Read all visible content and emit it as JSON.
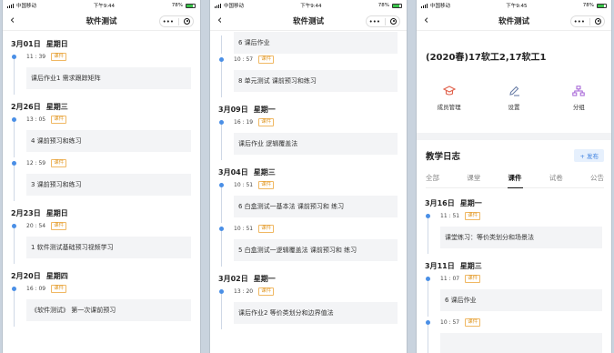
{
  "status": {
    "carrier": "中国移动",
    "time1": "下午9:44",
    "time2": "下午9:44",
    "time3": "下午9:45",
    "battery_text": "78%",
    "battery_level": 0.78
  },
  "nav": {
    "title": "软件测试",
    "more": "•••"
  },
  "colors": {
    "accent": "#4a8fe6",
    "badge": "#e19a2a",
    "publish": "#3a7fe0"
  },
  "phone1": [
    {
      "date": "3月01日",
      "weekday": "星期日",
      "entries": [
        {
          "time": "11 : 39",
          "badge": "课件",
          "text": "课后作业1 需求跟踪矩阵"
        }
      ]
    },
    {
      "date": "2月26日",
      "weekday": "星期三",
      "entries": [
        {
          "time": "13 : 05",
          "badge": "课件",
          "text": "4 课前预习和练习"
        },
        {
          "time": "12 : 59",
          "badge": "课件",
          "text": "3 课前预习和练习"
        }
      ]
    },
    {
      "date": "2月23日",
      "weekday": "星期日",
      "entries": [
        {
          "time": "20 : 54",
          "badge": "课件",
          "text": "1 软件测试基础预习视频学习"
        }
      ]
    },
    {
      "date": "2月20日",
      "weekday": "星期四",
      "entries": [
        {
          "time": "16 : 09",
          "badge": "课件",
          "text": "《软件测试》 第一次课前预习"
        }
      ]
    }
  ],
  "phone2": {
    "top_card": "6 课后作业",
    "top_entry": {
      "time": "10 : 57",
      "badge": "课件",
      "text": "8 单元测试 课前预习和练习"
    },
    "groups": [
      {
        "date": "3月09日",
        "weekday": "星期一",
        "entries": [
          {
            "time": "16 : 19",
            "badge": "课件",
            "text": "课后作业 逻辑覆盖法"
          }
        ]
      },
      {
        "date": "3月04日",
        "weekday": "星期三",
        "entries": [
          {
            "time": "10 : 51",
            "badge": "课件",
            "text": "6 白盒测试一基本法 课前预习和 练习"
          },
          {
            "time": "10 : 51",
            "badge": "课件",
            "text": "5 白盒测试一逻辑覆盖法 课前预习和 练习"
          }
        ]
      },
      {
        "date": "3月02日",
        "weekday": "星期一",
        "entries": [
          {
            "time": "13 : 20",
            "badge": "课件",
            "text": "课后作业2 等价类划分和边界值法"
          }
        ]
      }
    ]
  },
  "phone3": {
    "class_title": "(2020春)17软工2,17软工1",
    "quick": [
      {
        "icon": "graduation-cap-icon",
        "label": "成员管理"
      },
      {
        "icon": "pen-icon",
        "label": "设置"
      },
      {
        "icon": "group-tree-icon",
        "label": "分组"
      }
    ],
    "log_title": "教学日志",
    "publish": "+ 发布",
    "tabs": [
      "全部",
      "课堂",
      "课件",
      "试卷",
      "公告"
    ],
    "active_tab": "课件",
    "groups": [
      {
        "date": "3月16日",
        "weekday": "星期一",
        "entries": [
          {
            "time": "11 : 51",
            "badge": "课件",
            "text": "课堂练习：等价类划分和场景法"
          }
        ]
      },
      {
        "date": "3月11日",
        "weekday": "星期三",
        "entries": [
          {
            "time": "11 : 07",
            "badge": "课件",
            "text": "6 课后作业"
          },
          {
            "time": "10 : 57",
            "badge": "课件",
            "text": ""
          }
        ]
      }
    ]
  }
}
